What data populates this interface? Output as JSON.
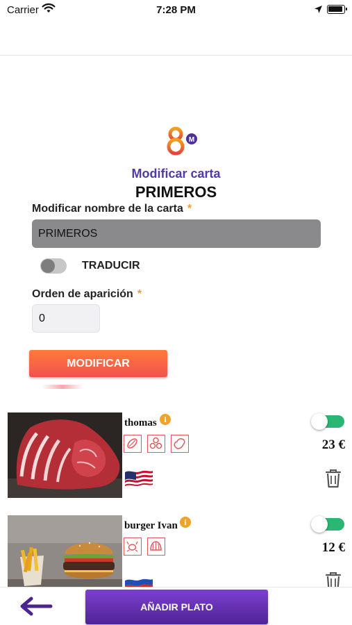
{
  "status_bar": {
    "carrier": "Carrier",
    "time": "7:28 PM"
  },
  "header": {
    "subtitle": "Modificar carta",
    "menu_name": "PRIMEROS"
  },
  "form": {
    "name_label": "Modificar nombre de la carta",
    "required_mark": "*",
    "name_value": "PRIMEROS",
    "translate_label": "TRADUCIR",
    "translate_on": false,
    "order_label": "Orden de aparición",
    "order_value": "0",
    "modify_button": "MODIFICAR"
  },
  "dishes": [
    {
      "name": "thomas",
      "info_icon": "info-icon",
      "allergen_icons": [
        "gluten-icon",
        "lupin-icon",
        "peanut-icon"
      ],
      "flag": "usa-flag-icon",
      "enabled": true,
      "price": "23 €"
    },
    {
      "name": "burger Ivan",
      "info_icon": "info-icon",
      "allergen_icons": [
        "crustacean-icon",
        "mollusc-icon"
      ],
      "flag": "russia-flag-icon",
      "enabled": true,
      "price": "12 €"
    }
  ],
  "bottom_bar": {
    "back_icon": "arrow-left-icon",
    "add_button": "AÑADIR PLATO"
  },
  "colors": {
    "brand_purple": "#4f3aa8",
    "orange_accent": "#f0a22a",
    "modify_gradient": [
      "#ff7a3a",
      "#f0524e"
    ],
    "add_gradient": [
      "#7d3fcf",
      "#4f2497"
    ],
    "toggle_on": "#2bb673",
    "allergen_red": "#e2575d"
  }
}
